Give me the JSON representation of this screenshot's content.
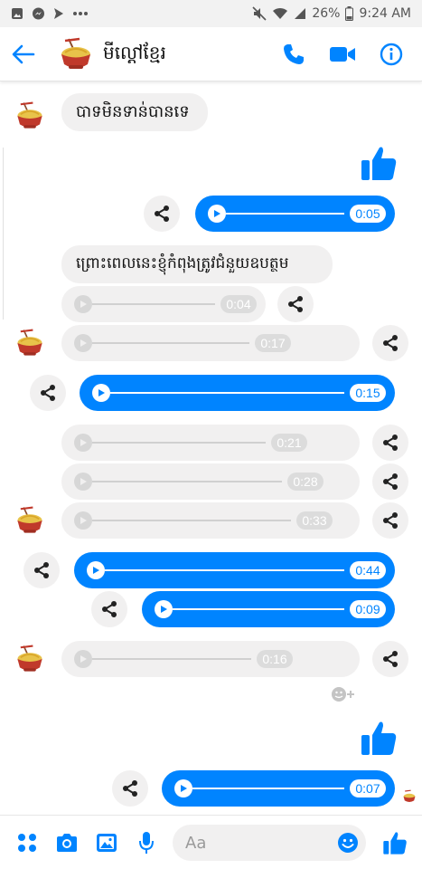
{
  "status_bar": {
    "battery": "26%",
    "time": "9:24 AM"
  },
  "header": {
    "title": "មីល្ដៅខ្មែរ"
  },
  "colors": {
    "accent": "#0084ff",
    "incoming_bubble": "#f1f0f0"
  },
  "messages": {
    "m1_text": "បាទមិនទាន់បានទេ",
    "m3_duration": "0:05",
    "m4_text": "ព្រោះពេលនេះខ្ញុំកំពុងត្រូវជំនួយឧបត្ថម",
    "m5_duration": "0:04",
    "m6_duration": "0:17",
    "m7_duration": "0:15",
    "m8_duration": "0:21",
    "m9_duration": "0:28",
    "m10_duration": "0:33",
    "m11_duration": "0:44",
    "m12_duration": "0:09",
    "m13_duration": "0:16",
    "m15_duration": "0:07"
  },
  "composer": {
    "placeholder": "Aa"
  },
  "icons": [
    "back-arrow-icon",
    "phone-icon",
    "video-camera-icon",
    "info-icon",
    "share-icon",
    "play-icon",
    "thumbs-up-icon",
    "add-reaction-icon",
    "apps-grid-icon",
    "camera-icon",
    "gallery-icon",
    "microphone-icon",
    "emoji-icon"
  ]
}
